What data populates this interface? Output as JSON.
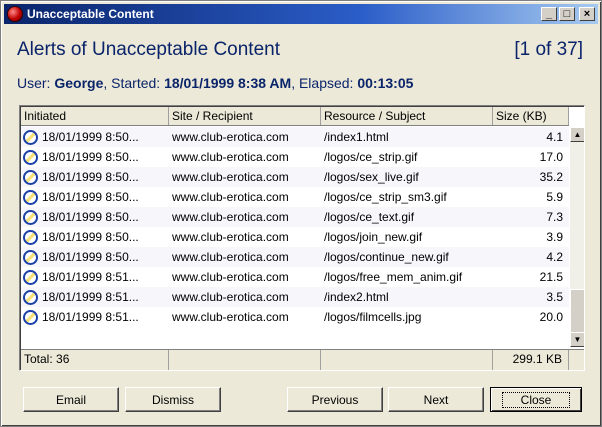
{
  "window": {
    "title": "Unacceptable Content",
    "minimize": "_",
    "maximize": "□",
    "close": "×"
  },
  "header": {
    "title": "Alerts of Unacceptable Content",
    "counter": "[1 of 37]"
  },
  "session": {
    "user_label": "User: ",
    "user": "George",
    "started_label": ", Started: ",
    "started": "18/01/1999 8:38 AM",
    "elapsed_label": ", Elapsed: ",
    "elapsed": "00:13:05"
  },
  "table": {
    "columns": [
      "Initiated",
      "Site / Recipient",
      "Resource / Subject",
      "Size (KB)"
    ],
    "rows": [
      {
        "initiated": "18/01/1999 8:50...",
        "site": "www.club-erotica.com",
        "resource": "/index1.html",
        "size": "4.1"
      },
      {
        "initiated": "18/01/1999 8:50...",
        "site": "www.club-erotica.com",
        "resource": "/logos/ce_strip.gif",
        "size": "17.0"
      },
      {
        "initiated": "18/01/1999 8:50...",
        "site": "www.club-erotica.com",
        "resource": "/logos/sex_live.gif",
        "size": "35.2"
      },
      {
        "initiated": "18/01/1999 8:50...",
        "site": "www.club-erotica.com",
        "resource": "/logos/ce_strip_sm3.gif",
        "size": "5.9"
      },
      {
        "initiated": "18/01/1999 8:50...",
        "site": "www.club-erotica.com",
        "resource": "/logos/ce_text.gif",
        "size": "7.3"
      },
      {
        "initiated": "18/01/1999 8:50...",
        "site": "www.club-erotica.com",
        "resource": "/logos/join_new.gif",
        "size": "3.9"
      },
      {
        "initiated": "18/01/1999 8:50...",
        "site": "www.club-erotica.com",
        "resource": "/logos/continue_new.gif",
        "size": "4.2"
      },
      {
        "initiated": "18/01/1999 8:51...",
        "site": "www.club-erotica.com",
        "resource": "/logos/free_mem_anim.gif",
        "size": "21.5"
      },
      {
        "initiated": "18/01/1999 8:51...",
        "site": "www.club-erotica.com",
        "resource": "/index2.html",
        "size": "3.5"
      },
      {
        "initiated": "18/01/1999 8:51...",
        "site": "www.club-erotica.com",
        "resource": "/logos/filmcells.jpg",
        "size": "20.0"
      }
    ],
    "total_label": "Total: 36",
    "total_size": "299.1 KB"
  },
  "buttons": {
    "email": "Email",
    "dismiss": "Dismiss",
    "previous": "Previous",
    "next": "Next",
    "close": "Close"
  },
  "icons": {
    "app": "alert-globe-icon",
    "row": "globe-icon"
  }
}
